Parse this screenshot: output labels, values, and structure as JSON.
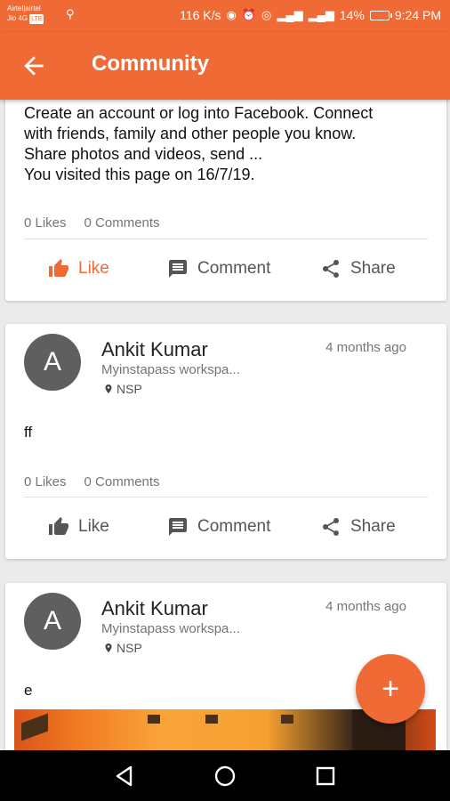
{
  "status_bar": {
    "carrier_line1": "Airtel|airtel",
    "carrier_line2": "Jio 4G",
    "carrier_badge": "LTE",
    "network_speed": "116 K/s",
    "battery": "14%",
    "time": "9:24 PM"
  },
  "app_bar": {
    "title": "Community"
  },
  "posts": [
    {
      "text_lines": [
        "Create an account or log into Facebook. Connect",
        "with friends, family and other people you know.",
        "Share photos and videos, send ...",
        "You visited this page on 16/7/19."
      ],
      "likes": "0 Likes",
      "comments": "0 Comments",
      "liked": true,
      "actions": {
        "like": "Like",
        "comment": "Comment",
        "share": "Share"
      }
    },
    {
      "avatar_letter": "A",
      "author": "Ankit Kumar",
      "time": "4 months ago",
      "workspace": "Myinstapass workspa...",
      "location": "NSP",
      "text": "ff",
      "likes": "0 Likes",
      "comments": "0 Comments",
      "liked": false,
      "actions": {
        "like": "Like",
        "comment": "Comment",
        "share": "Share"
      }
    },
    {
      "avatar_letter": "A",
      "author": "Ankit Kumar",
      "time": "4 months ago",
      "workspace": "Myinstapass workspa...",
      "location": "NSP",
      "text": "e"
    }
  ],
  "fab": {
    "label": "+"
  },
  "colors": {
    "accent": "#f06a35",
    "avatar": "#5f5f5f",
    "nav_bar": "#000000"
  }
}
